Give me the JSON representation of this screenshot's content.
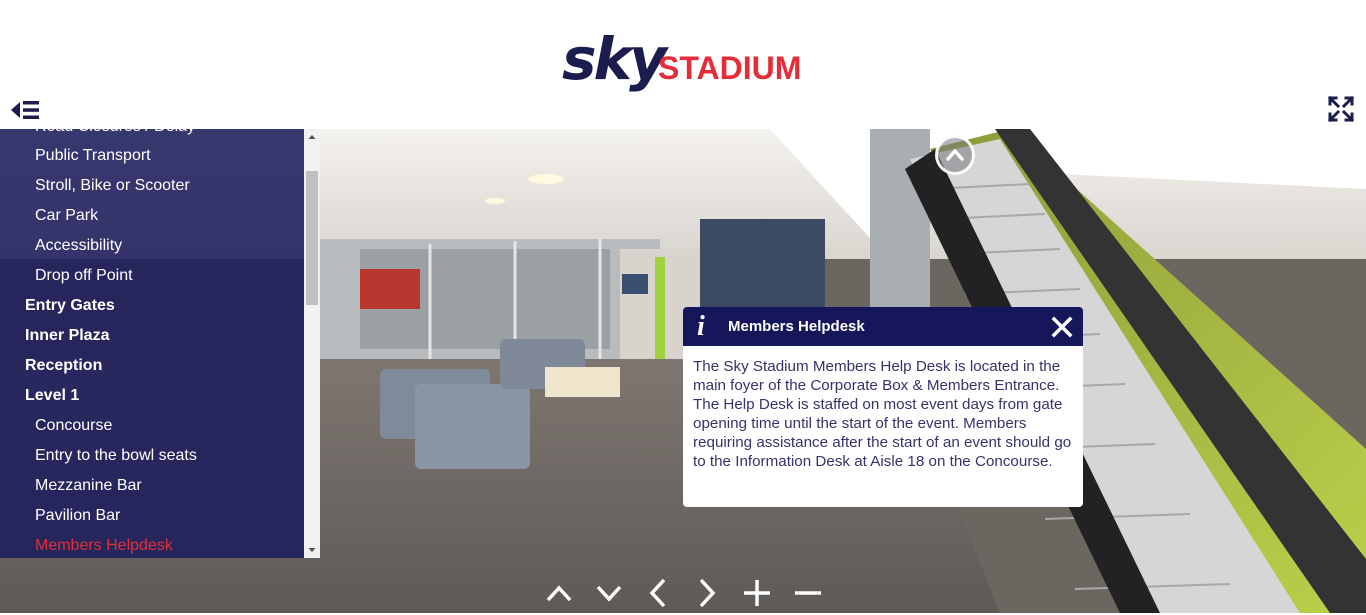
{
  "header": {
    "logo_sky": "sky",
    "logo_stadium": "STADIUM",
    "brand_colors": {
      "navy": "#1a1d4e",
      "red": "#e52d3a"
    },
    "menu_icon": "menu-collapse-icon",
    "fullscreen_icon": "fullscreen-icon"
  },
  "sidebar": {
    "items": [
      {
        "label": "Road Closures / Delay",
        "level": "sub"
      },
      {
        "label": "Public Transport",
        "level": "sub"
      },
      {
        "label": "Stroll, Bike or Scooter",
        "level": "sub"
      },
      {
        "label": "Car Park",
        "level": "sub"
      },
      {
        "label": "Accessibility",
        "level": "sub"
      },
      {
        "label": "Drop off Point",
        "level": "sub"
      },
      {
        "label": "Entry Gates",
        "level": "top"
      },
      {
        "label": "Inner Plaza",
        "level": "top"
      },
      {
        "label": "Reception",
        "level": "top"
      },
      {
        "label": "Level 1",
        "level": "top"
      },
      {
        "label": "Concourse",
        "level": "sub"
      },
      {
        "label": "Entry to the bowl seats",
        "level": "sub"
      },
      {
        "label": "Mezzanine Bar",
        "level": "sub"
      },
      {
        "label": "Pavilion Bar",
        "level": "sub"
      },
      {
        "label": "Members Helpdesk",
        "level": "sub",
        "active": true
      }
    ],
    "active_color": "#e52d3a"
  },
  "popup": {
    "icon": "info-icon",
    "icon_glyph": "i",
    "title": "Members Helpdesk",
    "body": "The Sky Stadium Members Help Desk is located in the main foyer of the Corporate Box & Members Entrance. The Help Desk is staffed on most event days from gate opening time until the start of the event. Members requiring assistance after the start of an event should go to the Information Desk at Aisle 18 on the Concourse.",
    "close_icon": "close-icon"
  },
  "hotspot": {
    "icon": "chevron-up-icon"
  },
  "controls": [
    "chevron-up-icon",
    "chevron-down-icon",
    "chevron-left-icon",
    "chevron-right-icon",
    "plus-icon",
    "minus-icon"
  ]
}
